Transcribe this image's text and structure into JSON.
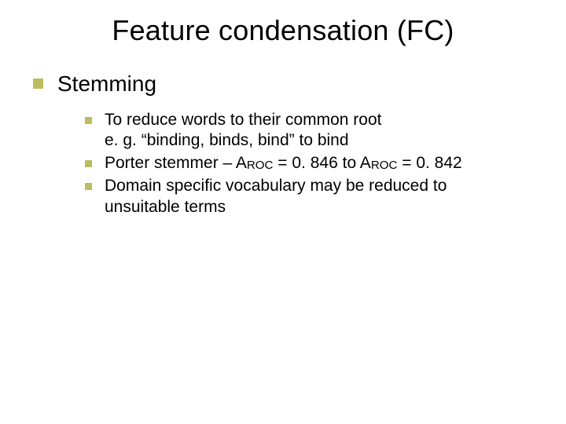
{
  "title": "Feature condensation (FC)",
  "level1": {
    "heading": "Stemming"
  },
  "bullets": [
    {
      "line1": "To reduce words to their common root",
      "line2": "e. g. “binding, binds, bind” to bind"
    },
    {
      "prefix": "Porter stemmer – A",
      "sub1": "ROC",
      "mid": " = 0. 846 to A",
      "sub2": "ROC",
      "suffix": " = 0. 842"
    },
    {
      "line1": "Domain specific vocabulary may be reduced to",
      "line2": "unsuitable terms"
    }
  ]
}
